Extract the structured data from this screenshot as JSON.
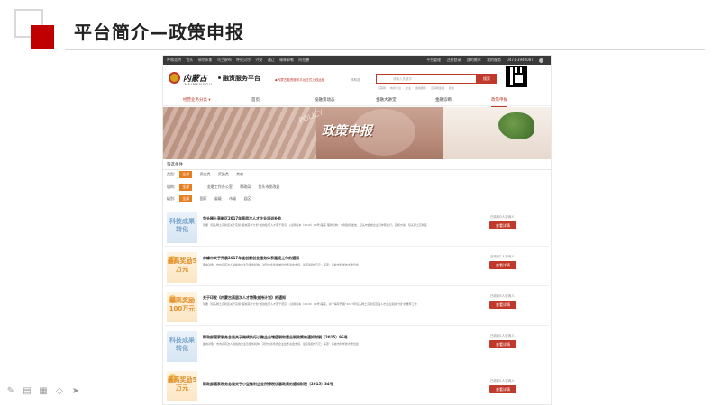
{
  "slide": {
    "title": "平台简介—政策申报"
  },
  "site": {
    "topbar": {
      "left": [
        "呼和浩特",
        "包头",
        "鄂尔多斯",
        "乌兰察布",
        "呼伦贝尔",
        "兴安",
        "通辽",
        "锡林郭勒",
        "阿拉善"
      ],
      "right": [
        "平台管理",
        "注册登录",
        "我的需求",
        "我的服务",
        "0471-3940087"
      ]
    },
    "header": {
      "logo_calligraphy": "内蒙古",
      "logo_en": "NEIMENGGU",
      "logo_name": "融资服务平台",
      "notice": "◆内蒙古融资服务平台正式上线运营",
      "notice_link": "呼和浩",
      "search_placeholder": "请输入关键字",
      "search_button": "搜索",
      "hot_words": [
        "互联网",
        "电商平台",
        "企业",
        "金融服务",
        "互联网金融",
        "新政"
      ]
    },
    "nav": {
      "category": "经营业务分类 ▾",
      "items": [
        "首页",
        "投融资动态",
        "金融大讲堂",
        "金融诊断",
        "政策申报"
      ]
    },
    "banner": {
      "title": "政策申报",
      "en": "POLICY"
    },
    "filter": {
      "title": "筛选条件",
      "rows": [
        {
          "label": "类型:",
          "options": [
            "全部",
            "资金类",
            "奖励类",
            "其他"
          ]
        },
        {
          "label": "机构:",
          "options": [
            "全部",
            "",
            "金融工作办公室",
            "财政局",
            "包头市发改委"
          ]
        },
        {
          "label": "级别:",
          "options": [
            "全部",
            "国家",
            "省级",
            "市级",
            "县区"
          ]
        }
      ]
    },
    "items": [
      {
        "thumb": "科技成果转化",
        "title": "包头稀土高新区2017年高层次人才企业培训补助",
        "desc": "简要（包头稀土高新区关于实施“鹿城英才计划”加快集聚人才若干意见）(试用版本（2016）10号)事宜\n理财机构：市财政局发放，包头市各类企业可参照执行，实施方案：包头稀土高新区",
        "meta": "已收到0人咨询人",
        "button": "查看详情"
      },
      {
        "thumb": "最高奖励5万元",
        "title": "赤峰市关于开展2017年度创新创业服务体系建设工作的通知",
        "desc": "面向对象：市内具有法人资格的企业及服务机构；对符合条件的单位给予资金支持，最高奖励5万元；来源：赤峰市科学技术委员会",
        "meta": "已收到1人咨询人",
        "button": "查看详情"
      },
      {
        "thumb": "最高奖励100万元",
        "title": "关于印发《内蒙古高层次人才特殊支持计划》的通知",
        "desc": "简要（包头稀土高新区关于实施“鹿城英才计划”加快集聚人才若干意见）(试用版本（2016）10号)事宜，并于每年开展“2017年包头稀土高新区百强人才企业奖励计划”的推荐工作",
        "meta": "已收到5人咨询人",
        "button": "查看详情"
      },
      {
        "thumb": "科技成果转化",
        "title": "财政部国家税务总局关于继续执行小微企业增值税和营业税政策的通知财税〔2015〕96号",
        "desc": "面向对象：市内具有法人资格的企业及服务机构；对符合条件的企业给予资金支持，最高奖励5万元；来源：赤峰市科学技术委员会",
        "meta": "已收到1人咨询人",
        "button": "查看详情"
      },
      {
        "thumb": "最高奖励5万元",
        "title": "财政部国家税务总局关于小型微利企业所得税优惠政策的通知财税〔2015〕34号",
        "desc": "",
        "meta": "已收到1人咨询人",
        "button": "查看详情"
      }
    ]
  },
  "toolbar": [
    "pen-icon",
    "slides-icon",
    "grid-icon",
    "eraser-icon",
    "pointer-icon"
  ]
}
